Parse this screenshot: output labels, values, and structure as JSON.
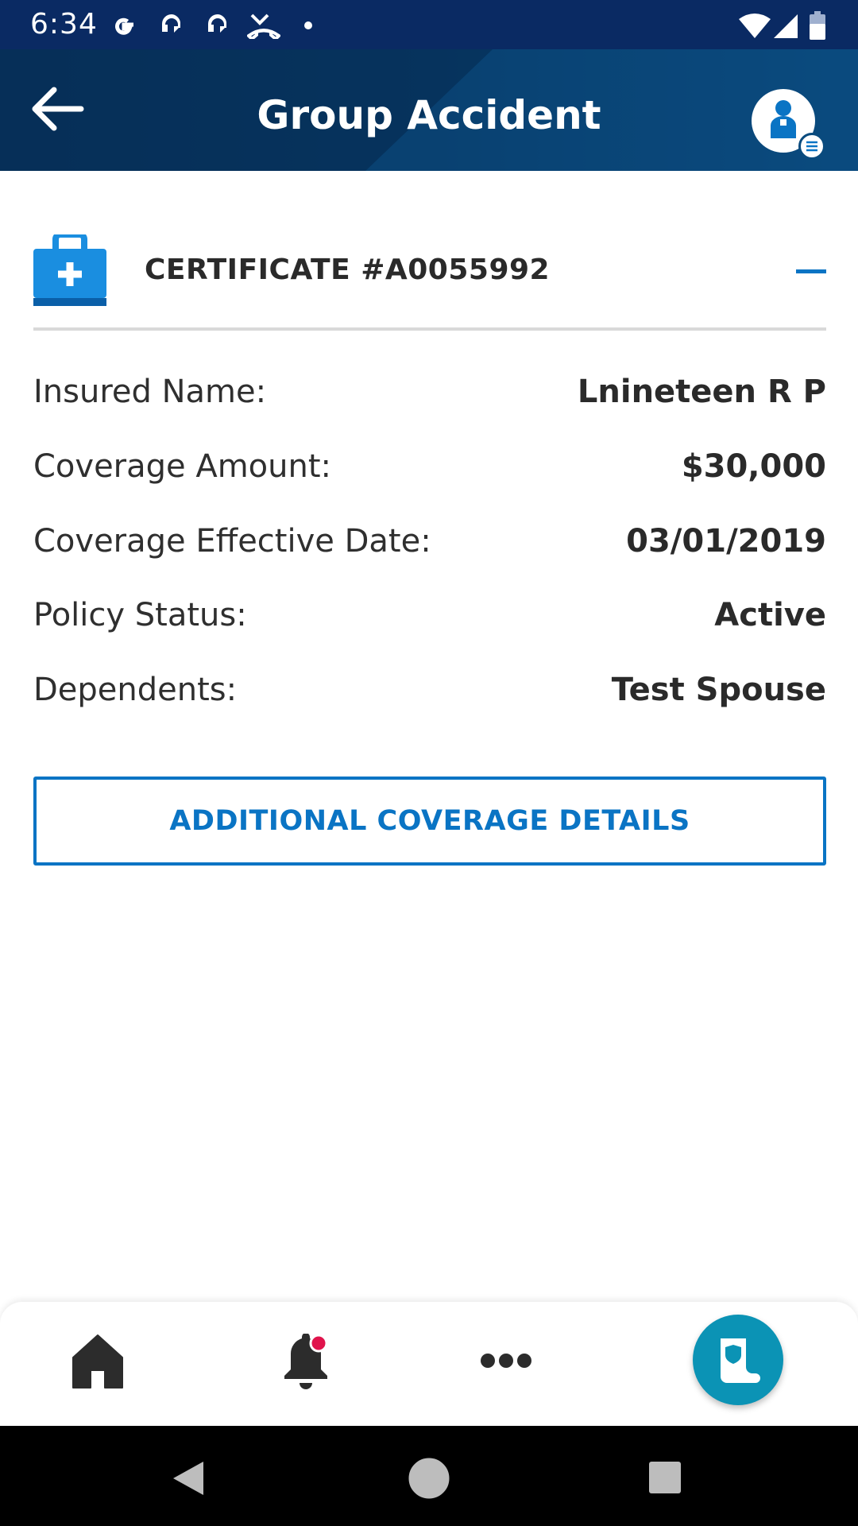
{
  "status_bar": {
    "time": "6:34",
    "notification_icons": [
      "google-icon",
      "headset-icon",
      "headset-icon",
      "missed-call-icon",
      "dot-icon"
    ],
    "system_icons": [
      "wifi-icon",
      "signal-icon",
      "battery-icon"
    ]
  },
  "app_bar": {
    "title": "Group Accident",
    "back_icon": "arrow-left-icon",
    "profile_icon": "person-icon"
  },
  "certificate": {
    "title": "CERTIFICATE #A0055992",
    "icon": "medical-kit-icon",
    "collapse_icon": "minus-icon",
    "details": [
      {
        "label": "Insured Name:",
        "value": "Lnineteen R P"
      },
      {
        "label": "Coverage Amount:",
        "value": "$30,000"
      },
      {
        "label": "Coverage Effective Date:",
        "value": "03/01/2019"
      },
      {
        "label": "Policy Status:",
        "value": "Active"
      },
      {
        "label": "Dependents:",
        "value": "Test Spouse"
      }
    ],
    "button_label": "ADDITIONAL COVERAGE DETAILS"
  },
  "bottom_nav": {
    "items": [
      "home-icon",
      "bell-icon",
      "more-icon",
      "policy-icon"
    ],
    "notification_dot_color": "#e0144c"
  },
  "colors": {
    "status_bar": "#0a2a63",
    "app_bar": "#073660",
    "accent": "#0a74c4",
    "fab": "#0b93b5"
  }
}
